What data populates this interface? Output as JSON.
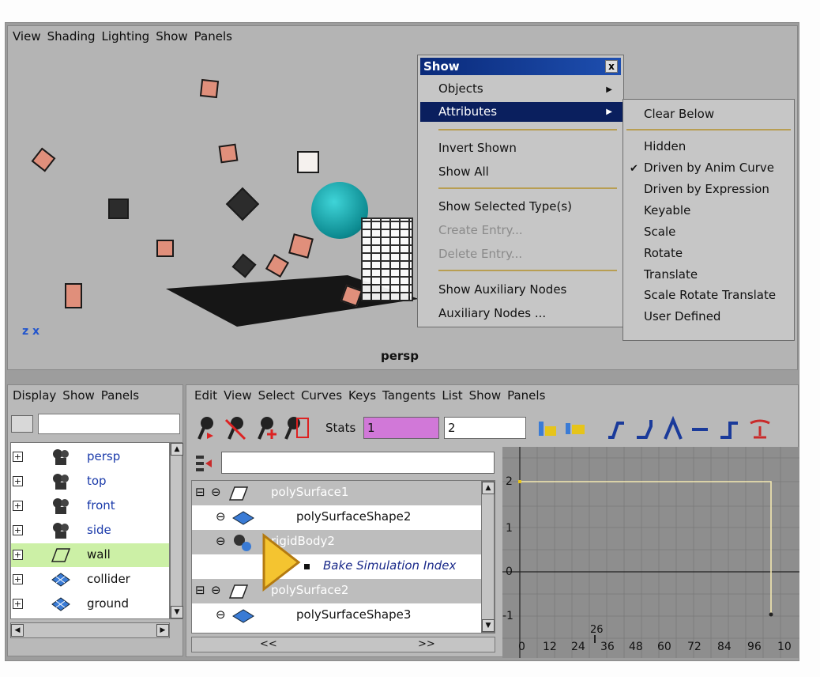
{
  "viewport": {
    "menu": [
      "View",
      "Shading",
      "Lighting",
      "Show",
      "Panels"
    ],
    "camera_label": "persp",
    "axis_label": "z x"
  },
  "show_menu": {
    "title": "Show",
    "close_glyph": "x",
    "items": {
      "objects": "Objects",
      "attributes": "Attributes",
      "invert_shown": "Invert Shown",
      "show_all": "Show All",
      "show_selected_types": "Show Selected Type(s)",
      "create_entry": "Create Entry...",
      "delete_entry": "Delete Entry...",
      "show_aux_nodes": "Show Auxiliary Nodes",
      "aux_nodes": "Auxiliary Nodes ..."
    },
    "submenu": {
      "clear_below": "Clear Below",
      "hidden": "Hidden",
      "driven_anim": "Driven by Anim Curve",
      "driven_expr": "Driven by Expression",
      "keyable": "Keyable",
      "scale": "Scale",
      "rotate": "Rotate",
      "translate": "Translate",
      "srt": "Scale Rotate Translate",
      "user_defined": "User Defined",
      "checked": "driven_anim"
    }
  },
  "outliner": {
    "menu": [
      "Display",
      "Show",
      "Panels"
    ],
    "items": [
      {
        "name": "persp",
        "icon": "camera-icon"
      },
      {
        "name": "top",
        "icon": "camera-icon"
      },
      {
        "name": "front",
        "icon": "camera-icon"
      },
      {
        "name": "side",
        "icon": "camera-icon"
      },
      {
        "name": "wall",
        "icon": "plane-icon"
      },
      {
        "name": "collider",
        "icon": "mesh-icon"
      },
      {
        "name": "ground",
        "icon": "mesh-icon"
      }
    ],
    "highlighted": "wall"
  },
  "graph_editor": {
    "menu": [
      "Edit",
      "View",
      "Select",
      "Curves",
      "Keys",
      "Tangents",
      "List",
      "Show",
      "Panels"
    ],
    "stats_label": "Stats",
    "stats_value1": "1",
    "stats_value2": "2",
    "rows": [
      {
        "name": "polySurface1",
        "kind": "transform"
      },
      {
        "name": "polySurfaceShape2",
        "kind": "shape"
      },
      {
        "name": "rigidBody2",
        "kind": "rigid"
      },
      {
        "name": "Bake Simulation Index",
        "kind": "attr"
      },
      {
        "name": "polySurface2",
        "kind": "transform"
      },
      {
        "name": "polySurfaceShape3",
        "kind": "shape"
      }
    ],
    "scroll_left": "<<",
    "scroll_right": ">>",
    "y_ticks": [
      "2",
      "1",
      "0",
      "-1"
    ],
    "x_ticks": [
      "0",
      "12",
      "24",
      "36",
      "48",
      "60",
      "72",
      "84",
      "96",
      "10"
    ],
    "current_frame": "26",
    "curve_color": "#f3e8b0",
    "background_color": "#8e8e8e"
  }
}
